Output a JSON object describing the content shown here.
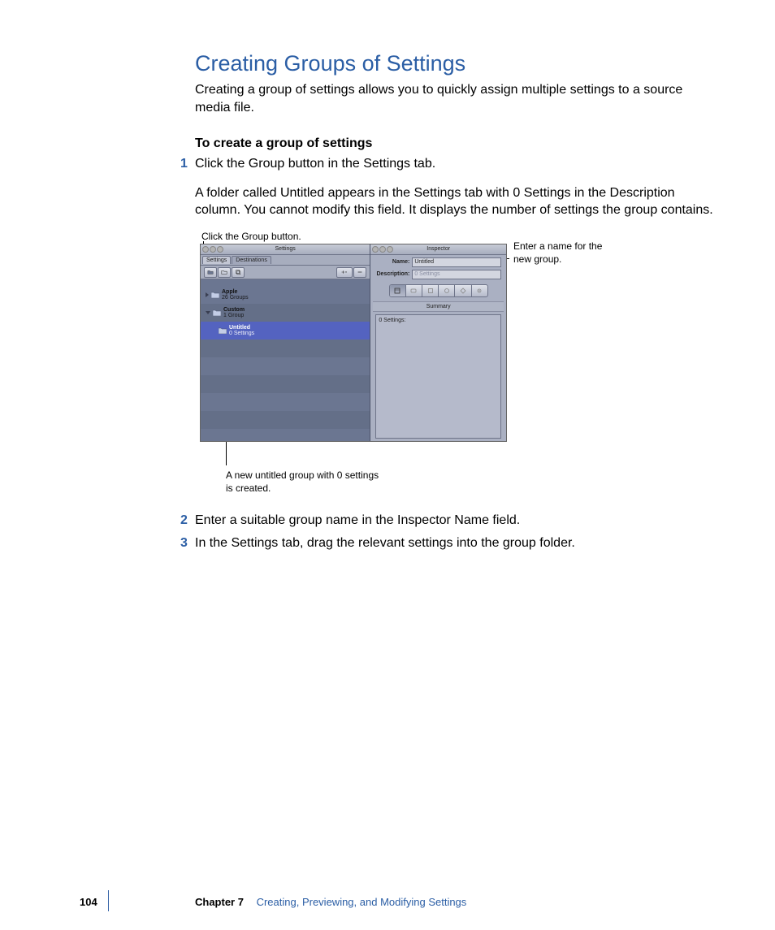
{
  "heading": "Creating Groups of Settings",
  "intro": "Creating a group of settings allows you to quickly assign multiple settings to a source media file.",
  "subhead": "To create a group of settings",
  "steps": [
    {
      "text": "Click the Group button in the Settings tab.",
      "detail": "A folder called Untitled appears in the Settings tab with 0 Settings in the Description column. You cannot modify this field. It displays the number of settings the group contains."
    },
    {
      "text": "Enter a suitable group name in the Inspector Name field."
    },
    {
      "text": "In the Settings tab, drag the relevant settings into the group folder."
    }
  ],
  "callouts": {
    "top": "Click the Group button.",
    "right": "Enter a name for the new group.",
    "bottom": "A new untitled group with 0 settings is created."
  },
  "screenshot": {
    "settingsPanel": {
      "title": "Settings",
      "tabs": [
        "Settings",
        "Destinations"
      ],
      "rows": [
        {
          "name": "Apple",
          "sub": "26 Groups",
          "expanded": false
        },
        {
          "name": "Custom",
          "sub": "1 Group",
          "expanded": true
        },
        {
          "name": "Untitled",
          "sub": "0 Settings",
          "selected": true,
          "indent": true
        }
      ]
    },
    "inspectorPanel": {
      "title": "Inspector",
      "nameLabel": "Name:",
      "nameValue": "Untitled",
      "descLabel": "Description:",
      "descValue": "0 Settings",
      "summaryLabel": "Summary",
      "summaryBody": "0 Settings:"
    }
  },
  "footer": {
    "page": "104",
    "chapterLabel": "Chapter 7",
    "chapterTitle": "Creating, Previewing, and Modifying Settings"
  }
}
